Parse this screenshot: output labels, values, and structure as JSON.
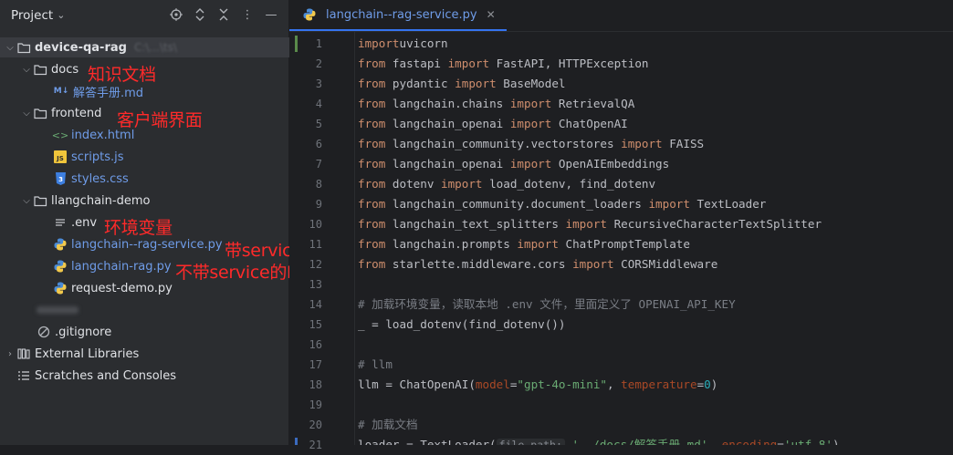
{
  "project_panel": {
    "title": "Project",
    "tree": [
      {
        "label": "device-qa-rag",
        "type": "folder",
        "depth": 0,
        "expanded": true,
        "bold": true,
        "path_hint": "C:\\...\\ts\\"
      },
      {
        "label": "docs",
        "type": "folder",
        "depth": 1,
        "expanded": true
      },
      {
        "label": "解答手册.md",
        "type": "markdown",
        "depth": 2
      },
      {
        "label": "frontend",
        "type": "folder",
        "depth": 1,
        "expanded": true
      },
      {
        "label": "index.html",
        "type": "html",
        "depth": 2
      },
      {
        "label": "scripts.js",
        "type": "js",
        "depth": 2
      },
      {
        "label": "styles.css",
        "type": "css",
        "depth": 2
      },
      {
        "label": "llangchain-demo",
        "type": "folder",
        "depth": 1,
        "expanded": true
      },
      {
        "label": ".env",
        "type": "text",
        "depth": 2
      },
      {
        "label": "langchain--rag-service.py",
        "type": "python",
        "depth": 2
      },
      {
        "label": "langchain-rag.py",
        "type": "python",
        "depth": 2
      },
      {
        "label": "request-demo.py",
        "type": "python",
        "depth": 2
      },
      {
        "label": "",
        "type": "blurred",
        "depth": 1
      },
      {
        "label": ".gitignore",
        "type": "ignore",
        "depth": 1
      },
      {
        "label": "External Libraries",
        "type": "libraries",
        "depth": 0,
        "expanded": false
      },
      {
        "label": "Scratches and Consoles",
        "type": "scratches",
        "depth": 0
      }
    ]
  },
  "annotations": {
    "docs": "知识文档",
    "frontend": "客户端界面",
    "env": "环境变量",
    "service": "带service的RAG",
    "norag": "不带service的RAG"
  },
  "editor": {
    "tab_label": "langchain--rag-service.py",
    "line_numbers": [
      "1",
      "2",
      "3",
      "4",
      "5",
      "6",
      "7",
      "8",
      "9",
      "10",
      "11",
      "12",
      "13",
      "14",
      "15",
      "16",
      "17",
      "18",
      "19",
      "20",
      "21"
    ],
    "inlay_hint": "file_path:",
    "code_lines": [
      [
        [
          "kw",
          "import"
        ],
        [
          "",
          "uvicorn"
        ]
      ],
      [
        [
          "kw",
          "from"
        ],
        [
          "",
          " fastapi "
        ],
        [
          "kw",
          "import"
        ],
        [
          "",
          " FastAPI, HTTPException"
        ]
      ],
      [
        [
          "kw",
          "from"
        ],
        [
          "",
          " pydantic "
        ],
        [
          "kw",
          "import"
        ],
        [
          "",
          " BaseModel"
        ]
      ],
      [
        [
          "kw",
          "from"
        ],
        [
          "",
          " langchain.chains "
        ],
        [
          "kw",
          "import"
        ],
        [
          "",
          " RetrievalQA"
        ]
      ],
      [
        [
          "kw",
          "from"
        ],
        [
          "",
          " langchain_openai "
        ],
        [
          "kw",
          "import"
        ],
        [
          "",
          " ChatOpenAI"
        ]
      ],
      [
        [
          "kw",
          "from"
        ],
        [
          "",
          " langchain_community.vectorstores "
        ],
        [
          "kw",
          "import"
        ],
        [
          "",
          " FAISS"
        ]
      ],
      [
        [
          "kw",
          "from"
        ],
        [
          "",
          " langchain_openai "
        ],
        [
          "kw",
          "import"
        ],
        [
          "",
          " OpenAIEmbeddings"
        ]
      ],
      [
        [
          "kw",
          "from"
        ],
        [
          "",
          " dotenv "
        ],
        [
          "kw",
          "import"
        ],
        [
          "",
          " load_dotenv, find_dotenv"
        ]
      ],
      [
        [
          "kw",
          "from"
        ],
        [
          "",
          " langchain_community.document_loaders "
        ],
        [
          "kw",
          "import"
        ],
        [
          "",
          " TextLoader"
        ]
      ],
      [
        [
          "kw",
          "from"
        ],
        [
          "",
          " langchain_text_splitters "
        ],
        [
          "kw",
          "import"
        ],
        [
          "",
          " RecursiveCharacterTextSplitter"
        ]
      ],
      [
        [
          "kw",
          "from"
        ],
        [
          "",
          " langchain.prompts "
        ],
        [
          "kw",
          "import"
        ],
        [
          "",
          " ChatPromptTemplate"
        ]
      ],
      [
        [
          "kw",
          "from"
        ],
        [
          "",
          " starlette.middleware.cors "
        ],
        [
          "kw",
          "import"
        ],
        [
          "",
          " CORSMiddleware"
        ]
      ],
      [],
      [
        [
          "cm",
          "# 加载环境变量，读取本地 .env 文件，里面定义了 OPENAI_API_KEY"
        ]
      ],
      [
        [
          "",
          "_ = load_dotenv(find_dotenv())"
        ]
      ],
      [],
      [
        [
          "cm",
          "# llm"
        ]
      ],
      [
        [
          "",
          "llm = ChatOpenAI("
        ],
        [
          "param",
          "model"
        ],
        [
          "",
          "="
        ],
        [
          "str",
          "\"gpt-4o-mini\""
        ],
        [
          "",
          ", "
        ],
        [
          "param",
          "temperature"
        ],
        [
          "",
          "="
        ],
        [
          "num",
          "0"
        ],
        [
          "",
          ")"
        ]
      ],
      [],
      [
        [
          "cm",
          "# 加载文档"
        ]
      ],
      [
        [
          "",
          "loader = TextLoader("
        ],
        [
          "hint",
          "file_path:"
        ],
        [
          "str",
          " '../docs/解答手册.md'"
        ],
        [
          "",
          ", "
        ],
        [
          "param",
          "encoding"
        ],
        [
          "",
          "="
        ],
        [
          "str",
          "'utf-8'"
        ],
        [
          "",
          ")"
        ]
      ]
    ]
  }
}
